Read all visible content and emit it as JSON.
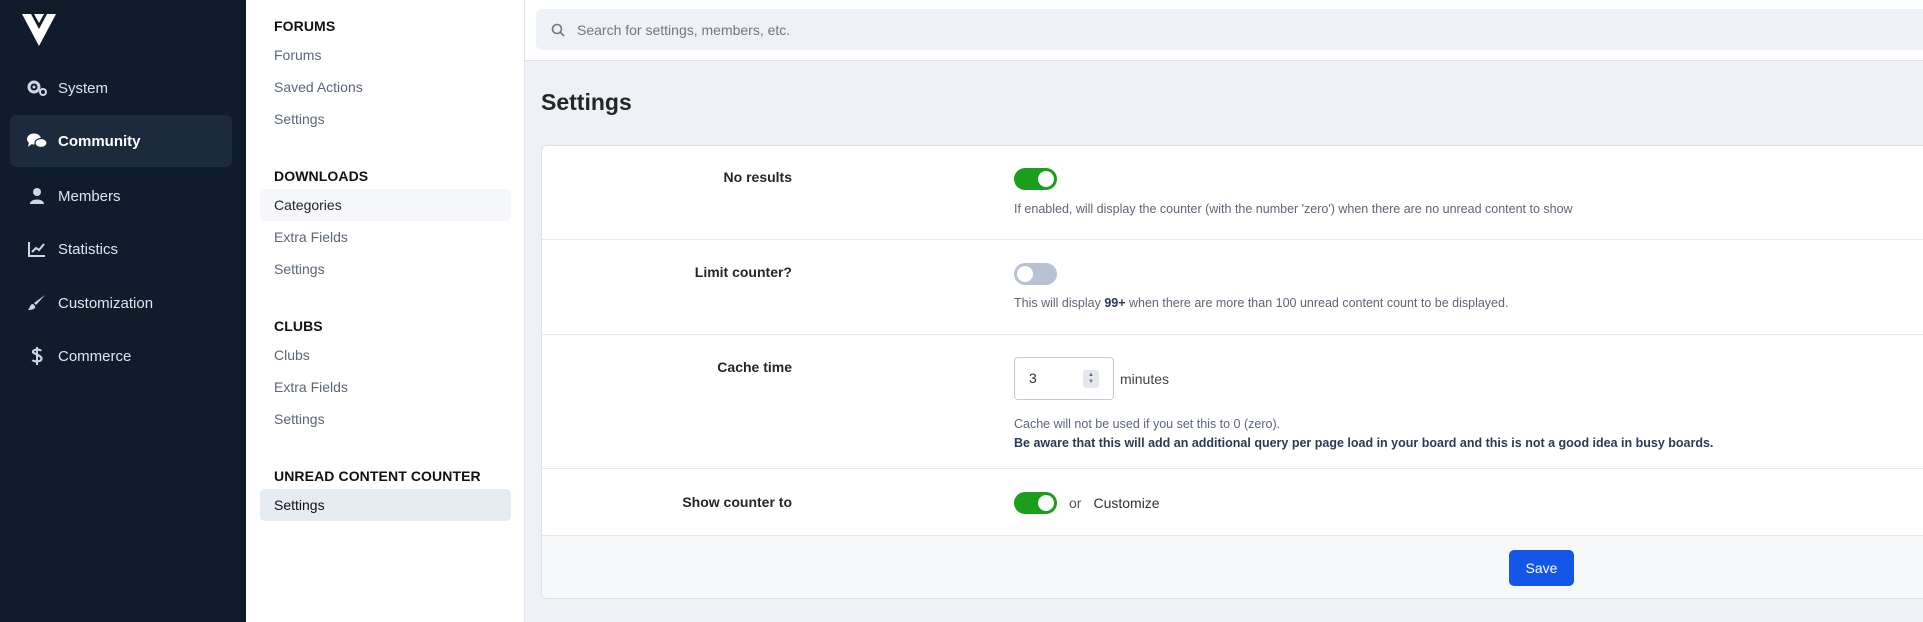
{
  "nav": {
    "items": [
      {
        "label": "System",
        "icon": "gears-icon"
      },
      {
        "label": "Community",
        "icon": "comments-icon"
      },
      {
        "label": "Members",
        "icon": "user-icon"
      },
      {
        "label": "Statistics",
        "icon": "chart-line-icon"
      },
      {
        "label": "Customization",
        "icon": "paintbrush-icon"
      },
      {
        "label": "Commerce",
        "icon": "dollar-icon"
      }
    ],
    "active": "Community"
  },
  "subnav": {
    "sections": [
      {
        "title": "FORUMS",
        "items": [
          "Forums",
          "Saved Actions",
          "Settings"
        ]
      },
      {
        "title": "DOWNLOADS",
        "items": [
          "Categories",
          "Extra Fields",
          "Settings"
        ]
      },
      {
        "title": "CLUBS",
        "items": [
          "Clubs",
          "Extra Fields",
          "Settings"
        ]
      },
      {
        "title": "UNREAD CONTENT COUNTER",
        "items": [
          "Settings"
        ]
      }
    ]
  },
  "search": {
    "placeholder": "Search for settings, members, etc."
  },
  "page": {
    "title": "Settings"
  },
  "settings": {
    "no_results": {
      "label": "No results",
      "enabled": true,
      "desc": "If enabled, will display the counter (with the number 'zero') when there are no unread content to show"
    },
    "limit_counter": {
      "label": "Limit counter?",
      "enabled": false,
      "desc_pre": "This will display ",
      "desc_bold": "99+",
      "desc_post": " when there are more than 100 unread content count to be displayed."
    },
    "cache_time": {
      "label": "Cache time",
      "value": "3",
      "unit": "minutes",
      "desc": "Cache will not be used if you set this to 0 (zero).",
      "warning": "Be aware that this will add an additional query per page load in your board and this is not a good idea in busy boards."
    },
    "show_counter": {
      "label": "Show counter to",
      "enabled": true,
      "or_text": "or",
      "customize_label": "Customize"
    }
  },
  "footer": {
    "save_label": "Save"
  },
  "colors": {
    "nav_bg": "#101c2c",
    "toggle_on": "#1b9e1b",
    "toggle_off": "#b8c2d2",
    "primary": "#1457e8"
  }
}
